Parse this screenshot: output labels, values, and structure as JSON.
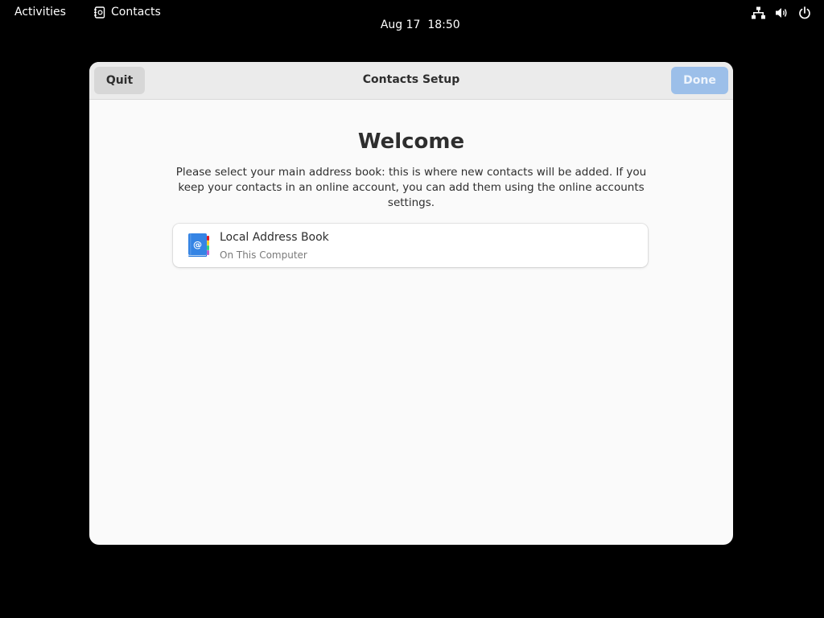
{
  "topbar": {
    "activities_label": "Activities",
    "app_name": "Contacts",
    "app_icon": "contacts-app-icon",
    "clock": "Aug 17  18:50",
    "status_icons": [
      "network-wired-icon",
      "volume-icon",
      "power-icon"
    ]
  },
  "dialog": {
    "title": "Contacts Setup",
    "quit_label": "Quit",
    "done_label": "Done",
    "done_enabled": false,
    "heading": "Welcome",
    "description": "Please select your main address book: this is where new contacts will be added. If you keep your contacts in an online account, you can add them using the online accounts settings.",
    "address_books": [
      {
        "icon": "address-book-icon",
        "title": "Local Address Book",
        "subtitle": "On This Computer"
      }
    ]
  },
  "colors": {
    "desktop": "#000000",
    "window_bg": "#fafafa",
    "headerbar_bg": "#ebebeb",
    "done_button_disabled": "#9cbfe9",
    "quit_button": "#d7d7d7",
    "address_book_icon": "#3584e4"
  }
}
